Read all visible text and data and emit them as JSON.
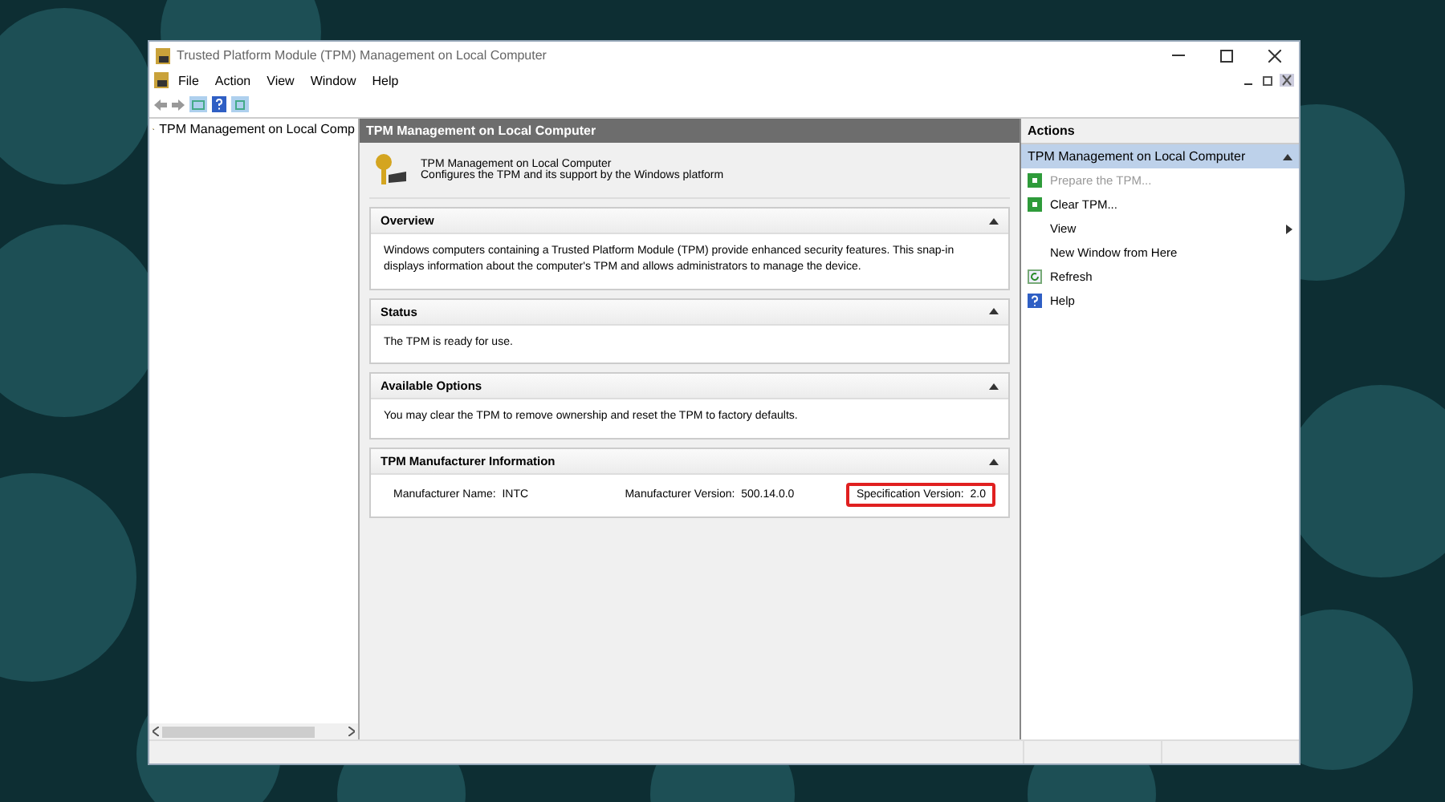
{
  "window": {
    "title": "Trusted Platform Module (TPM) Management on Local Computer"
  },
  "menu": [
    "File",
    "Action",
    "View",
    "Window",
    "Help"
  ],
  "tree": {
    "items": [
      {
        "label": "TPM Management on Local Comp",
        "selected": false
      }
    ]
  },
  "main": {
    "header": "TPM Management on Local Computer",
    "intro_title": "TPM Management on Local Computer",
    "intro_text": "Configures the TPM and its support by the Windows platform",
    "sections": [
      {
        "title": "Overview",
        "expanded": true,
        "text": "Windows computers containing a Trusted Platform Module (TPM) provide enhanced security features. This snap-in displays information about the computer's TPM and allows administrators to manage the device."
      },
      {
        "title": "Status",
        "expanded": true,
        "text": "The TPM is ready for use."
      },
      {
        "title": "Available Options",
        "expanded": true,
        "text": "You may clear the TPM to remove ownership and reset the TPM to factory defaults."
      },
      {
        "title": "TPM Manufacturer Information",
        "expanded": true,
        "fields": [
          {
            "label": "Manufacturer Name:",
            "value": "INTC",
            "highlighted": false
          },
          {
            "label": "Manufacturer Version:",
            "value": "500.14.0.0",
            "highlighted": false
          },
          {
            "label": "Specification Version:",
            "value": "2.0",
            "highlighted": true
          }
        ]
      }
    ]
  },
  "actions": {
    "header": "Actions",
    "group": "TPM Management on Local Computer",
    "items": [
      {
        "label": "Prepare the TPM...",
        "kind": "command",
        "disabled": true
      },
      {
        "label": "Clear TPM...",
        "kind": "command",
        "disabled": false
      },
      {
        "label": "View",
        "kind": "submenu",
        "disabled": false
      },
      {
        "label": "New Window from Here",
        "kind": "plain",
        "disabled": false
      },
      {
        "label": "Refresh",
        "kind": "refresh",
        "disabled": false
      },
      {
        "label": "Help",
        "kind": "help",
        "disabled": false
      }
    ]
  }
}
